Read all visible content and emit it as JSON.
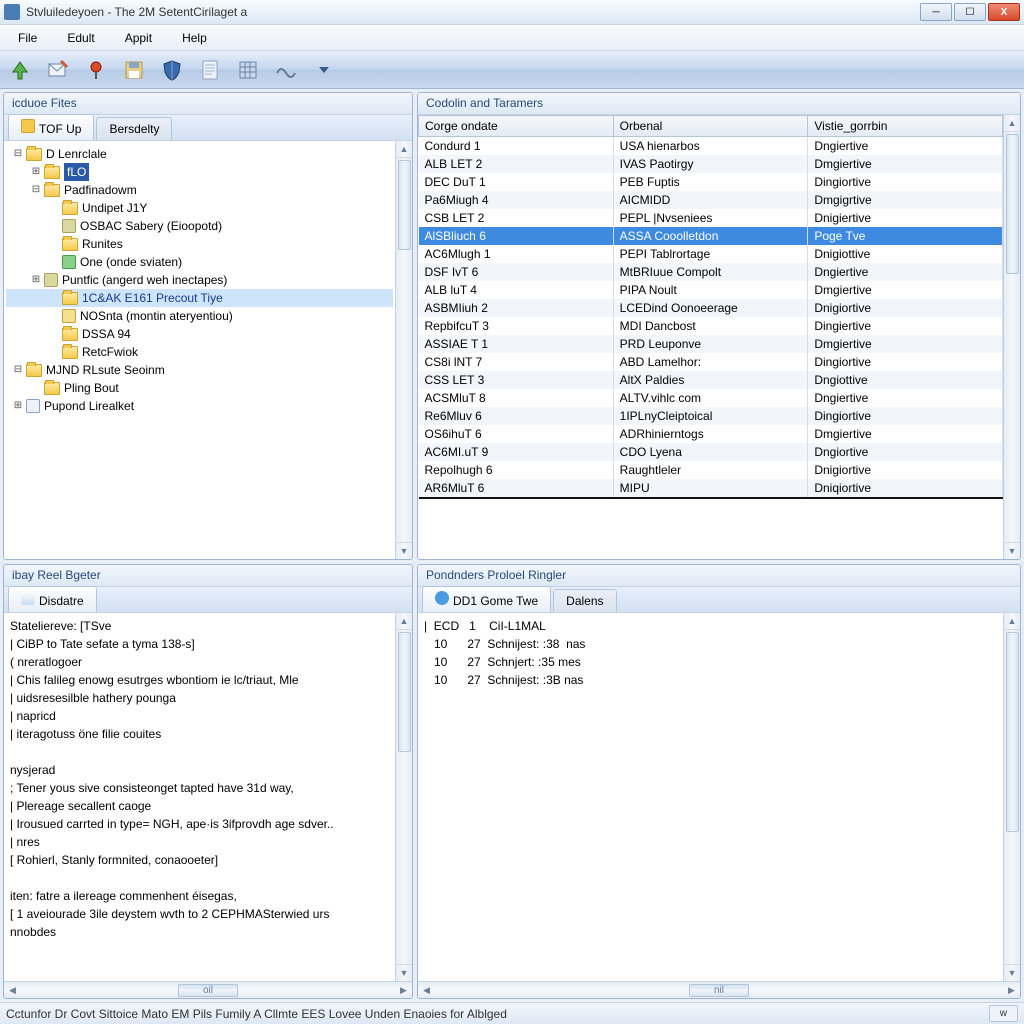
{
  "window": {
    "title": "Stvluiledeyoen - The 2M SetentCirilaget a"
  },
  "menu": [
    "File",
    "Edult",
    "Appit",
    "Help"
  ],
  "toolbar_icons": [
    "up-arrow",
    "mail-edit",
    "pin",
    "save",
    "shield",
    "page",
    "grid",
    "wave",
    "dropdown"
  ],
  "panels": {
    "tl": {
      "title": "icduoe Fites",
      "tabs": [
        "TOF Up",
        "Bersdelty"
      ]
    },
    "tr": {
      "title": "Codolin and Taramers"
    },
    "bl": {
      "title": "ibay Reel Bgeter",
      "tabs": [
        "Disdatre"
      ]
    },
    "br": {
      "title": "Pondnders Proloel Ringler",
      "tabs": [
        "DD1 Gome Twe",
        "Dalens"
      ]
    }
  },
  "tree": [
    {
      "d": 0,
      "exp": "-",
      "ic": "folder",
      "label": "D Lenrclale"
    },
    {
      "d": 1,
      "exp": "+",
      "ic": "folder",
      "label": "fLO",
      "hl": true
    },
    {
      "d": 1,
      "exp": "-",
      "ic": "folder",
      "label": "Padfinadowm"
    },
    {
      "d": 2,
      "exp": "",
      "ic": "folder",
      "label": "Undipet J1Y"
    },
    {
      "d": 2,
      "exp": "",
      "ic": "gear",
      "label": "OSBAC Sabery (Eioopotd)"
    },
    {
      "d": 2,
      "exp": "",
      "ic": "folder",
      "label": "Runites"
    },
    {
      "d": 2,
      "exp": "",
      "ic": "arrow",
      "label": "One (onde sviaten)"
    },
    {
      "d": 1,
      "exp": "+",
      "ic": "gear",
      "label": "Puntfic (angerd weh inectapes)"
    },
    {
      "d": 2,
      "exp": "",
      "ic": "folder",
      "label": "1C&AK E161 Precout Tiye",
      "sel": true
    },
    {
      "d": 2,
      "exp": "",
      "ic": "note",
      "label": "NOSnta (montin ateryentiou)"
    },
    {
      "d": 2,
      "exp": "",
      "ic": "folder",
      "label": "DSSA 94"
    },
    {
      "d": 2,
      "exp": "",
      "ic": "folder",
      "label": "RetcFwiok"
    },
    {
      "d": 0,
      "exp": "-",
      "ic": "folder",
      "label": "MJND RLsute Seoinm"
    },
    {
      "d": 1,
      "exp": "",
      "ic": "folder",
      "label": "Pling Bout"
    },
    {
      "d": 0,
      "exp": "+",
      "ic": "page",
      "label": "Pupond Lirealket"
    }
  ],
  "table": {
    "headers": [
      "Corge ondate",
      "Orbenal",
      "Vistie_gorrbin"
    ],
    "selected_index": 5,
    "rows": [
      [
        "Condurd  1",
        "USA hienarbos",
        "Dngiertive"
      ],
      [
        "ALB LET  2",
        "IVAS Paotirgy",
        "Dmgiertive"
      ],
      [
        "DEC DuT  1",
        "PEB Fuptis",
        "Dingiortive"
      ],
      [
        "Pa6Miugh 4",
        "AICMIDD",
        "Dmgigrtive"
      ],
      [
        "CSB LET  2",
        "PEPL |Nvseniees",
        "Dnigiertive"
      ],
      [
        "AlSBliuch 6",
        "ASSA Cooolletdon",
        "Poge Tve"
      ],
      [
        "AC6Mlugh 1",
        "PEPI Tablrortage",
        "Dnigiottive"
      ],
      [
        "DSF IvT  6",
        "MtBRIuue Compolt",
        "Dngiertive"
      ],
      [
        "ALB luT  4",
        "PIPA Noult",
        "Dmgiertive"
      ],
      [
        "ASBMIiuh 2",
        "LCEDind Oonoeerage",
        "Dnigiortive"
      ],
      [
        "RepbifcuT  3",
        "MDI Dancbost",
        "Dingiertive"
      ],
      [
        "ASSIAE T  1",
        "PRD Leuponve",
        "Dmgiertive"
      ],
      [
        "CS8i lNT  7",
        "ABD Lamelhor:",
        "Dingiortive"
      ],
      [
        "CSS LET  3",
        "AltX Paldies",
        "Dngiottive"
      ],
      [
        "ACSMluT  8",
        "ALTV.vihlc com",
        "Dngiertive"
      ],
      [
        "Re6Mluv  6",
        "1IPLnyCleiptoical",
        "Dingiortive"
      ],
      [
        "OS6ihuT  6",
        "ADRhinierntogs",
        "Dmgiertive"
      ],
      [
        "AC6MI.uT  9",
        "CDO Lyena",
        "Dngiortive"
      ],
      [
        "Repolhugh 6",
        "Raughtleler",
        "Dnigiortive"
      ],
      [
        "AR6MluT  6",
        "MIPU",
        "Dniqiortive"
      ]
    ]
  },
  "log_left": [
    "Stateliereve: [TSve",
    "| CiBP to Tate sefate a tyma 138-s]",
    "( nreratlogoer",
    "| Chis falileg enowg esutrges wbontiom ie lc/triaut, Mle",
    "| uidsresesilble hathery pounga",
    "| napricd",
    "| iteragotuss öne filie couites",
    "",
    "nysjerad",
    "; Tener yous sive consisteonget tapted have 31d way,",
    "| Plereage secallent caoge",
    "| Irousued carrted in type= NGH, ape·is 3ifprovdh age sdver..",
    "| nres",
    "[ Rohierl, Stanly formnited, conaooeter]",
    "",
    "iten: fatre a ilereage commenhent éisegas,",
    "[ 1 aveiourade 3ile deystem wvth to 2 CEPHMASterwied urs",
    "nnobdes"
  ],
  "log_right": [
    "|  ECD   1    CiI-L1MAL",
    "   10      27  Schnijest: :38  nas",
    "   10      27  Schnjert: :35 mes",
    "   10      27  Schnijest: :3B nas"
  ],
  "status": {
    "text": "Cctunfor Dr Covt Sittoice Mato EM Pils Fumily A Cllmte EES Lovee Unden Enaoies for Alblged",
    "btn": "w"
  },
  "colors": {
    "accent": "#3d8ae0"
  }
}
